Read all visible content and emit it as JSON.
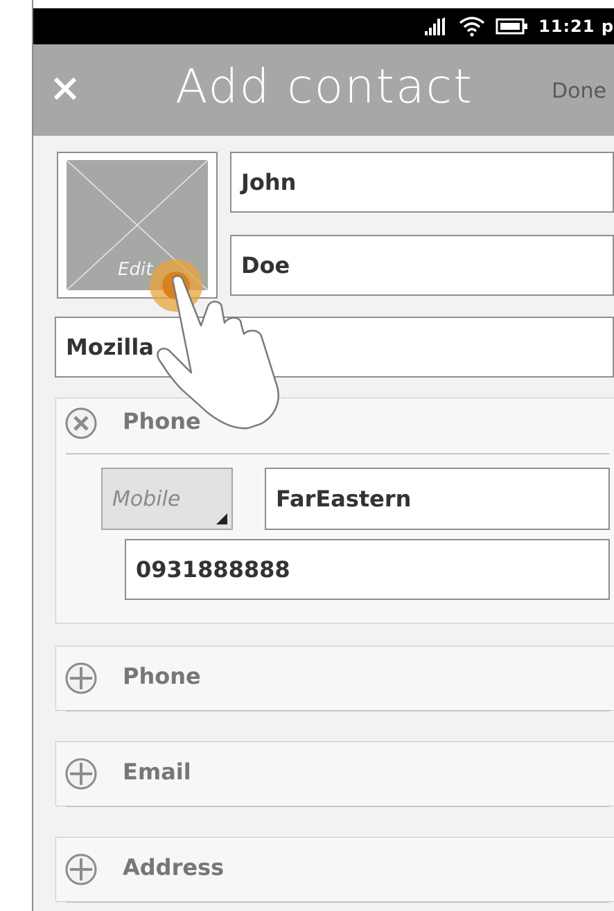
{
  "status_bar": {
    "time": "11:21 p"
  },
  "header": {
    "title": "Add contact",
    "done_label": "Done",
    "close_icon": "close-icon"
  },
  "photo": {
    "edit_label": "Edit"
  },
  "fields": {
    "first_name": "John",
    "last_name": "Doe",
    "company": "Mozilla"
  },
  "phone_section": {
    "label": "Phone",
    "type_value": "Mobile",
    "carrier_value": "FarEastern",
    "number_value": "0931888888"
  },
  "add_sections": [
    {
      "label": "Phone"
    },
    {
      "label": "Email"
    },
    {
      "label": "Address"
    }
  ],
  "colors": {
    "header_bg": "#a6a8a6",
    "status_bar_bg": "#000000",
    "touch_indicator": "#e8a33a"
  }
}
